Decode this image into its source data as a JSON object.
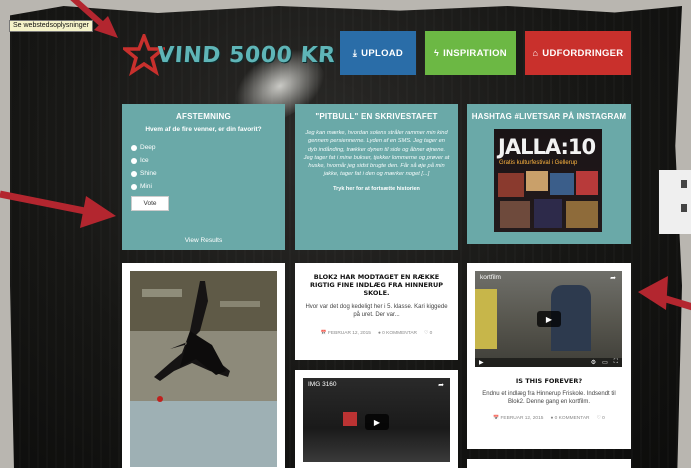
{
  "tooltip": "Se webstedsoplysninger",
  "logo": {
    "text": "VIND 5000 KR"
  },
  "nav": {
    "upload": {
      "icon": "download-icon",
      "label": "UPLOAD",
      "color": "#2a6da8"
    },
    "inspiration": {
      "icon": "bolt-icon",
      "label": "INSPIRATION",
      "color": "#6cb844"
    },
    "udfordringer": {
      "icon": "home-icon",
      "label": "UDFORDRINGER",
      "color": "#c9302c"
    }
  },
  "poll": {
    "title": "AFSTEMNING",
    "question": "Hvem af de fire venner, er din favorit?",
    "options": [
      "Deep",
      "Ice",
      "Shine",
      "Mini"
    ],
    "vote": "Vote",
    "view_results": "View Results"
  },
  "story": {
    "title": "\"PITBULL\"  EN SKRIVESTAFET",
    "text": "Jeg kan mærke, hvordan solens stråler rammer min kind gennem persiennerne. Lyden af en SMS. Jeg tager en dyb indånding, trækker dynen til side og åbner øjnene. Jeg tager fat i mine bukser, tjekker lommerne og prøver at huske, hvornår jeg sidst brugte den. Får så øje på min jakke, tager fat i den og mærker noget [...]",
    "link": "Tryk her for at fortsætte historien"
  },
  "instagram": {
    "title": "HASHTAG #LIVETSAR PÅ INSTAGRAM",
    "image_text": "JALLA:10",
    "image_sub": "Gratis kulturfestival i Gellerup"
  },
  "posts": {
    "blok": {
      "title": "BLOK2 HAR MODTAGET EN RÆKKE RIGTIG FINE INDLÆG FRA HINNERUP SKOLE.",
      "text": "Hvor var det dog kedeligt her i 5. klasse. Kari kiggede på uret. Der var...",
      "date": "FEBRUAR 12, 2015",
      "comments": "0 KOMMENTAR",
      "likes": "0"
    },
    "video1": {
      "title": "IMG 3160"
    },
    "kortfilm": {
      "video_title": "kortfilm",
      "title": "IS THIS FOREVER?",
      "text": "Endnu et indlæg fra Hinnerup Friskole. Indsendt til Blok2. Denne gang en kortfilm.",
      "date": "FEBRUAR 12, 2015",
      "comments": "0 KOMMENTAR",
      "likes": "0"
    }
  },
  "colors": {
    "annotation_arrow": "#b3262f",
    "box_teal": "#6aa9a8",
    "logo_star": "#c8302d"
  }
}
